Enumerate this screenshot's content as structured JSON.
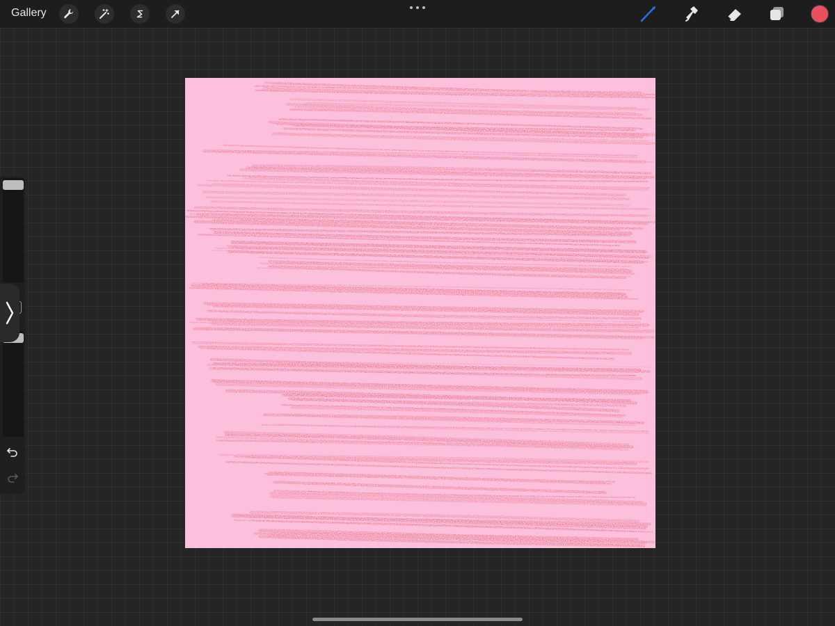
{
  "topbar": {
    "gallery_label": "Gallery",
    "tools_left": [
      {
        "name": "actions",
        "icon": "wrench-icon"
      },
      {
        "name": "adjustments",
        "icon": "magic-wand-icon"
      },
      {
        "name": "selection",
        "icon": "selection-s-icon"
      },
      {
        "name": "transform",
        "icon": "arrow-cursor-icon"
      }
    ],
    "tools_right": [
      {
        "name": "brush",
        "icon": "paintbrush-icon",
        "active": true
      },
      {
        "name": "smudge",
        "icon": "smudge-finger-icon",
        "active": false
      },
      {
        "name": "eraser",
        "icon": "eraser-icon",
        "active": false
      },
      {
        "name": "layers",
        "icon": "layers-icon",
        "active": false
      }
    ],
    "active_tool_color": "#2f6fe0",
    "current_color": "#e8505f"
  },
  "canvas": {
    "background_color": "#fcc0dd",
    "stroke_color": "#e15a62",
    "stroke_color_dark": "#d24653"
  },
  "sidebar": {
    "brush_size_slider": {
      "level": 1.0
    },
    "opacity_slider": {
      "level": 1.0
    },
    "toggle_icon": "chevron-right-icon",
    "undo_icon": "undo-icon",
    "redo_icon": "redo-icon"
  }
}
